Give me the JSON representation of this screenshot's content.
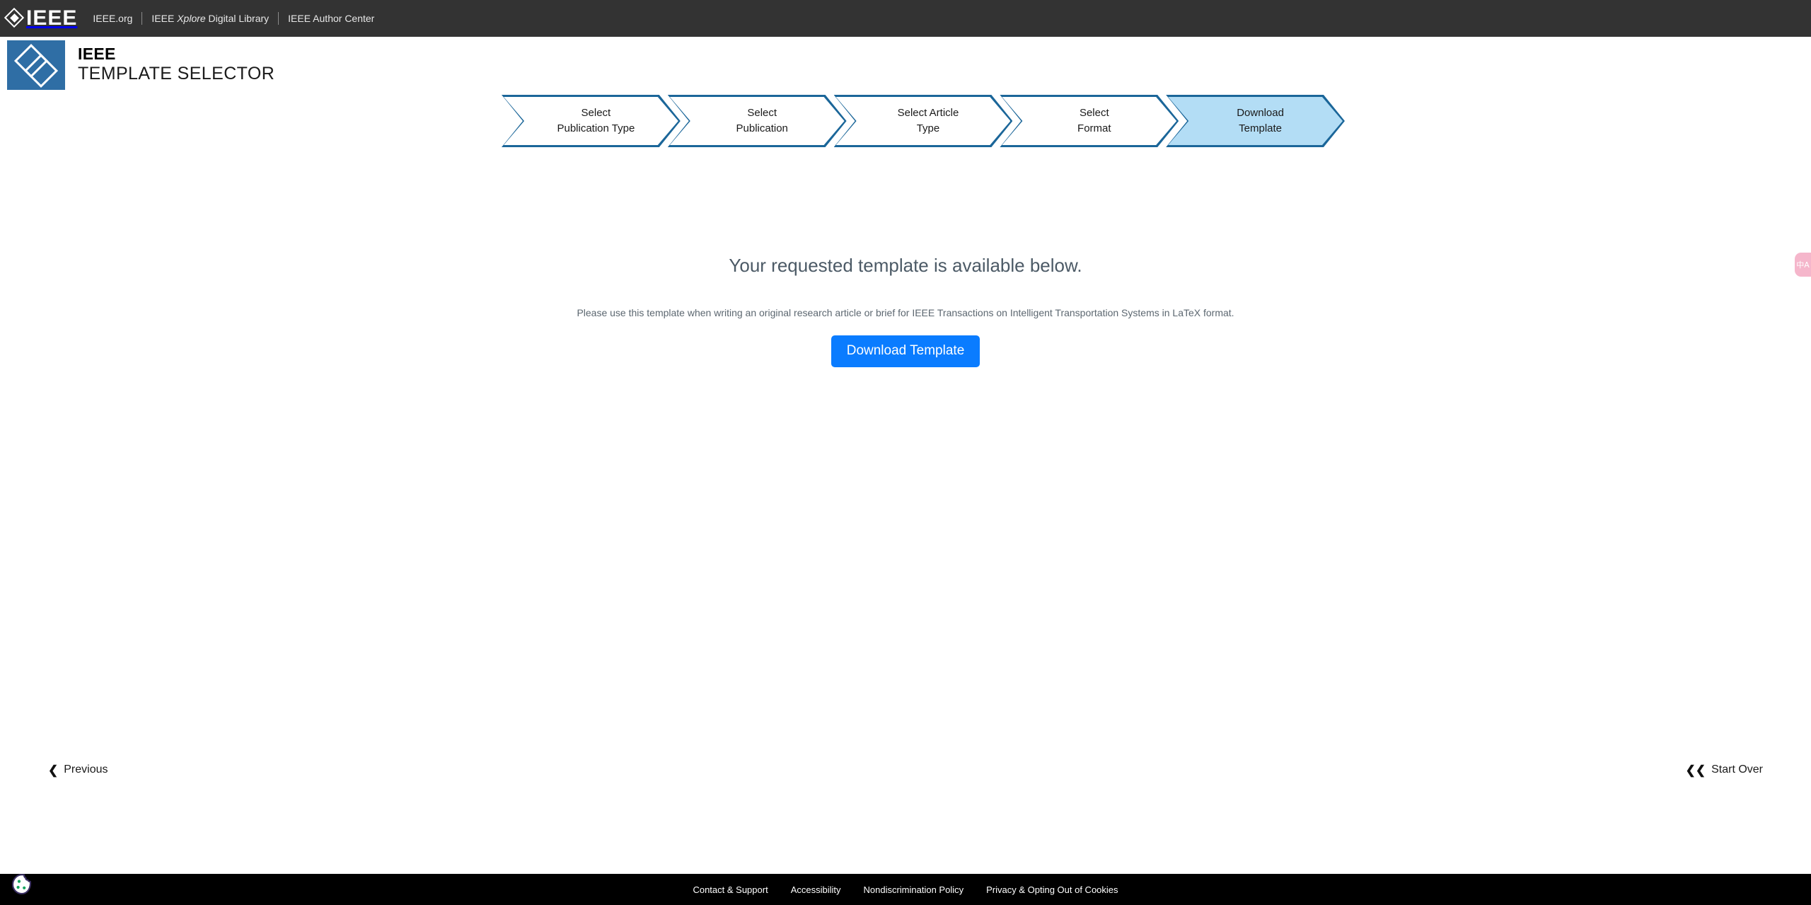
{
  "utility_bar": {
    "logo_text": "IEEE",
    "logo_icon": "ieee-diamond-logo-icon",
    "links": [
      {
        "label": "IEEE.org",
        "italic_part": ""
      },
      {
        "label": "IEEE Xplore Digital Library",
        "italic_part": "Xplore"
      },
      {
        "label": "IEEE Author Center",
        "italic_part": ""
      }
    ]
  },
  "brand": {
    "tile_icon": "ieee-double-diamond-icon",
    "line1": "IEEE",
    "line2": "TEMPLATE SELECTOR",
    "tile_color": "#2f6ea5"
  },
  "stepper": {
    "active_index": 4,
    "border_color": "#1b6699",
    "active_fill": "#b3ddf5",
    "inactive_fill": "#ffffff",
    "steps": [
      {
        "line1": "Select",
        "line2": "Publication Type",
        "label": "Select\nPublication Type",
        "state": "complete"
      },
      {
        "line1": "Select",
        "line2": "Publication",
        "label": "Select\nPublication",
        "state": "complete"
      },
      {
        "line1": "Select Article",
        "line2": "Type",
        "label": "Select Article\nType",
        "state": "complete"
      },
      {
        "line1": "Select",
        "line2": "Format",
        "label": "Select\nFormat",
        "state": "complete"
      },
      {
        "line1": "Download",
        "line2": "Template",
        "label": "Download\nTemplate",
        "state": "active"
      }
    ]
  },
  "main": {
    "headline": "Your requested template is available below.",
    "subtext": "Please use this template when writing an original research article or brief for IEEE Transactions on Intelligent Transportation Systems in LaTeX format.",
    "download_button_label": "Download Template",
    "download_button_color": "#0a7cff"
  },
  "bottom_nav": {
    "previous_label": "Previous",
    "previous_icon": "chevron-left-icon",
    "start_over_label": "Start Over",
    "start_over_icon": "double-chevron-left-icon"
  },
  "footer": {
    "background": "#000000",
    "links": [
      "Contact & Support",
      "Accessibility",
      "Nondiscrimination Policy",
      "Privacy & Opting Out of Cookies"
    ]
  },
  "widgets": {
    "cookie_icon": "cookie-consent-icon",
    "translate_tab_glyph": "中A",
    "translate_tab_color": "#f5b6cb"
  }
}
